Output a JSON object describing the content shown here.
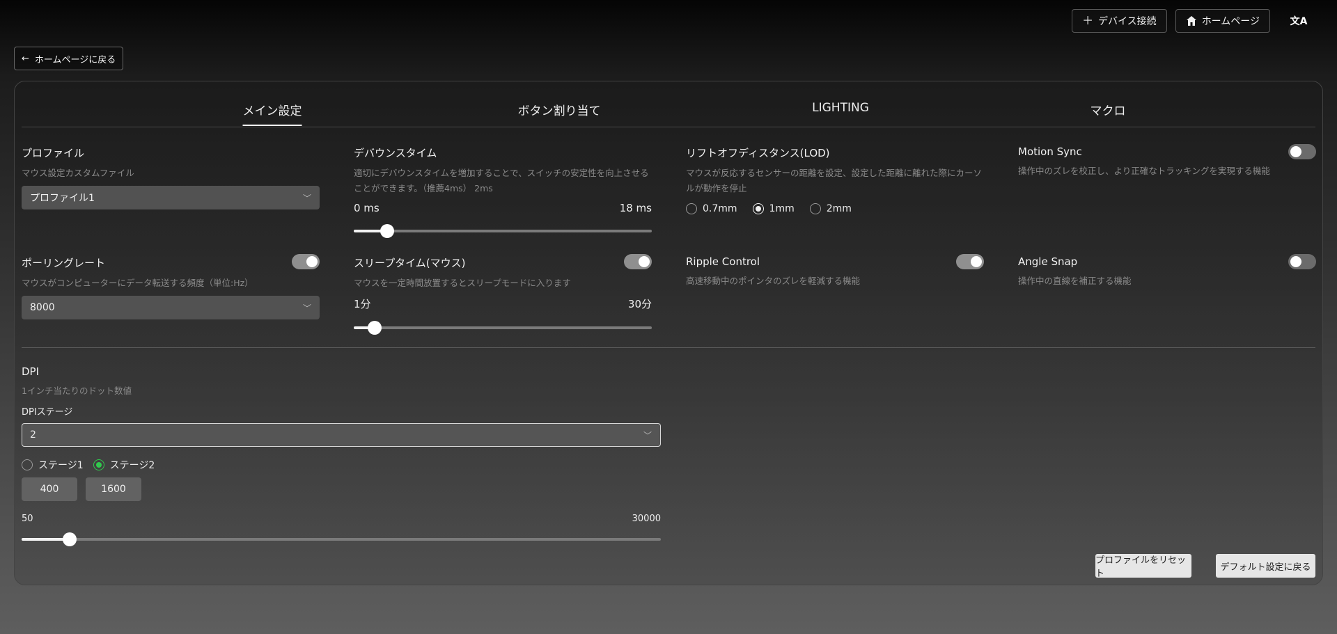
{
  "header": {
    "connect_label": "デバイス接続",
    "home_label": "ホームページ",
    "translate_glyph": "文A",
    "back_label": "ホームページに戻る"
  },
  "tabs": [
    {
      "label": "メイン設定",
      "active": true
    },
    {
      "label": "ボタン割り当て",
      "active": false
    },
    {
      "label": "LIGHTING",
      "active": false
    },
    {
      "label": "マクロ",
      "active": false
    }
  ],
  "profile": {
    "title": "プロファイル",
    "desc": "マウス設定カスタムファイル",
    "value": "プロファイル1"
  },
  "debounce": {
    "title": "デバウンスタイム",
    "desc": "適切にデバウンスタイムを増加することで、スイッチの安定性を向上させることができます。（推薦4ms）  2ms",
    "min_label": "0 ms",
    "max_label": "18 ms",
    "value": 2,
    "min": 0,
    "max": 18
  },
  "lod": {
    "title": "リフトオフディスタンス(LOD)",
    "desc": "マウスが反応するセンサーの距離を設定、設定した距離に離れた際にカーソルが動作を停止",
    "options": [
      "0.7mm",
      "1mm",
      "2mm"
    ],
    "selected": "1mm"
  },
  "motion_sync": {
    "title": "Motion Sync",
    "desc": "操作中のズレを校正し、より正確なトラッキングを実現する機能",
    "on": false
  },
  "polling": {
    "title": "ポーリングレート",
    "desc": "マウスがコンピューターにデータ転送する頻度（単位:Hz）",
    "value": "8000",
    "on": true
  },
  "sleep": {
    "title": "スリープタイム(マウス)",
    "desc": "マウスを一定時間放置するとスリープモードに入ります",
    "min_label": "1分",
    "max_label": "30分",
    "value": 3,
    "min": 1,
    "max": 30,
    "on": true
  },
  "ripple": {
    "title": "Ripple Control",
    "desc": "高速移動中のポインタのズレを軽減する機能",
    "on": true
  },
  "angle_snap": {
    "title": "Angle Snap",
    "desc": "操作中の直線を補正する機能",
    "on": false
  },
  "dpi": {
    "title": "DPI",
    "desc": "1インチ当たりのドット数値",
    "stage_label": "DPIステージ",
    "stage_value": "2",
    "stages": [
      {
        "label": "ステージ1",
        "value": "400"
      },
      {
        "label": "ステージ2",
        "value": "1600"
      }
    ],
    "selected_stage": "ステージ2",
    "min_label": "50",
    "max_label": "30000",
    "slider_value": 1600,
    "min": 50,
    "max": 30000
  },
  "footer": {
    "reset_label": "プロファイルをリセット",
    "default_label": "デフォルト設定に戻る"
  },
  "colors": {
    "active_radio": "#31c94d"
  }
}
